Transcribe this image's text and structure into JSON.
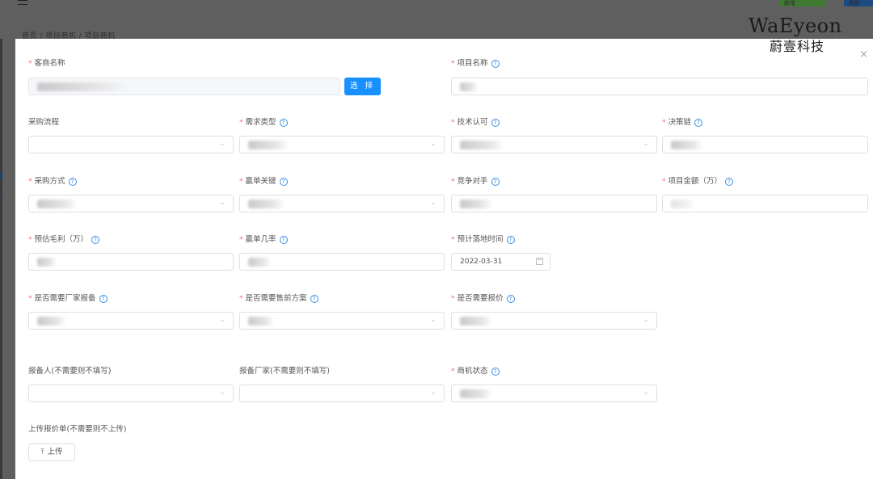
{
  "backdrop": {
    "breadcrumb": [
      "首页",
      "项目商机",
      "项目商机"
    ],
    "breadcrumb_sep": "/",
    "green_button": "新增",
    "blue_button": "刷新"
  },
  "watermark": {
    "en": "WaEyeon",
    "cn": "蔚壹科技"
  },
  "modal": {
    "close_label": "×",
    "customer_name": {
      "label": "客商名称",
      "required": true
    },
    "select_button": "选 择",
    "project_name": {
      "label": "项目名称",
      "required": true
    },
    "procurement_process": {
      "label": "采购流程",
      "required": false
    },
    "demand_type": {
      "label": "需求类型",
      "required": true
    },
    "tech_approval": {
      "label": "技术认可",
      "required": true
    },
    "decision_chain": {
      "label": "决策链",
      "required": true
    },
    "procurement_method": {
      "label": "采购方式",
      "required": true
    },
    "win_key": {
      "label": "赢单关键",
      "required": true
    },
    "competitor": {
      "label": "竞争对手",
      "required": true
    },
    "project_amount": {
      "label": "项目金额（万）",
      "required": true
    },
    "est_gross_profit": {
      "label": "预估毛利（万）",
      "required": true
    },
    "win_rate": {
      "label": "赢单几率",
      "required": true
    },
    "expected_landing": {
      "label": "预计落地时间",
      "required": true,
      "value": "2022-03-31"
    },
    "need_vendor_filing": {
      "label": "是否需要厂家报备",
      "required": true
    },
    "need_presales": {
      "label": "是否需要售前方案",
      "required": true
    },
    "need_quote": {
      "label": "是否需要报价",
      "required": true
    },
    "filer": {
      "label": "报备人(不需要则不填写)",
      "required": false
    },
    "filing_vendor": {
      "label": "报备厂家(不需要则不填写)",
      "required": false
    },
    "opportunity_status": {
      "label": "商机状态",
      "required": true
    },
    "upload_quote": {
      "label": "上传报价单(不需要则不上传)",
      "button": "上传"
    }
  },
  "colors": {
    "primary": "#1890ff",
    "required": "#f56c6c",
    "border": "#dcdfe6"
  },
  "icons": {
    "help": "question-circle-icon",
    "select_arrow": "chevron-down-icon",
    "date": "calendar-icon",
    "upload": "upload-icon",
    "close": "close-icon"
  }
}
